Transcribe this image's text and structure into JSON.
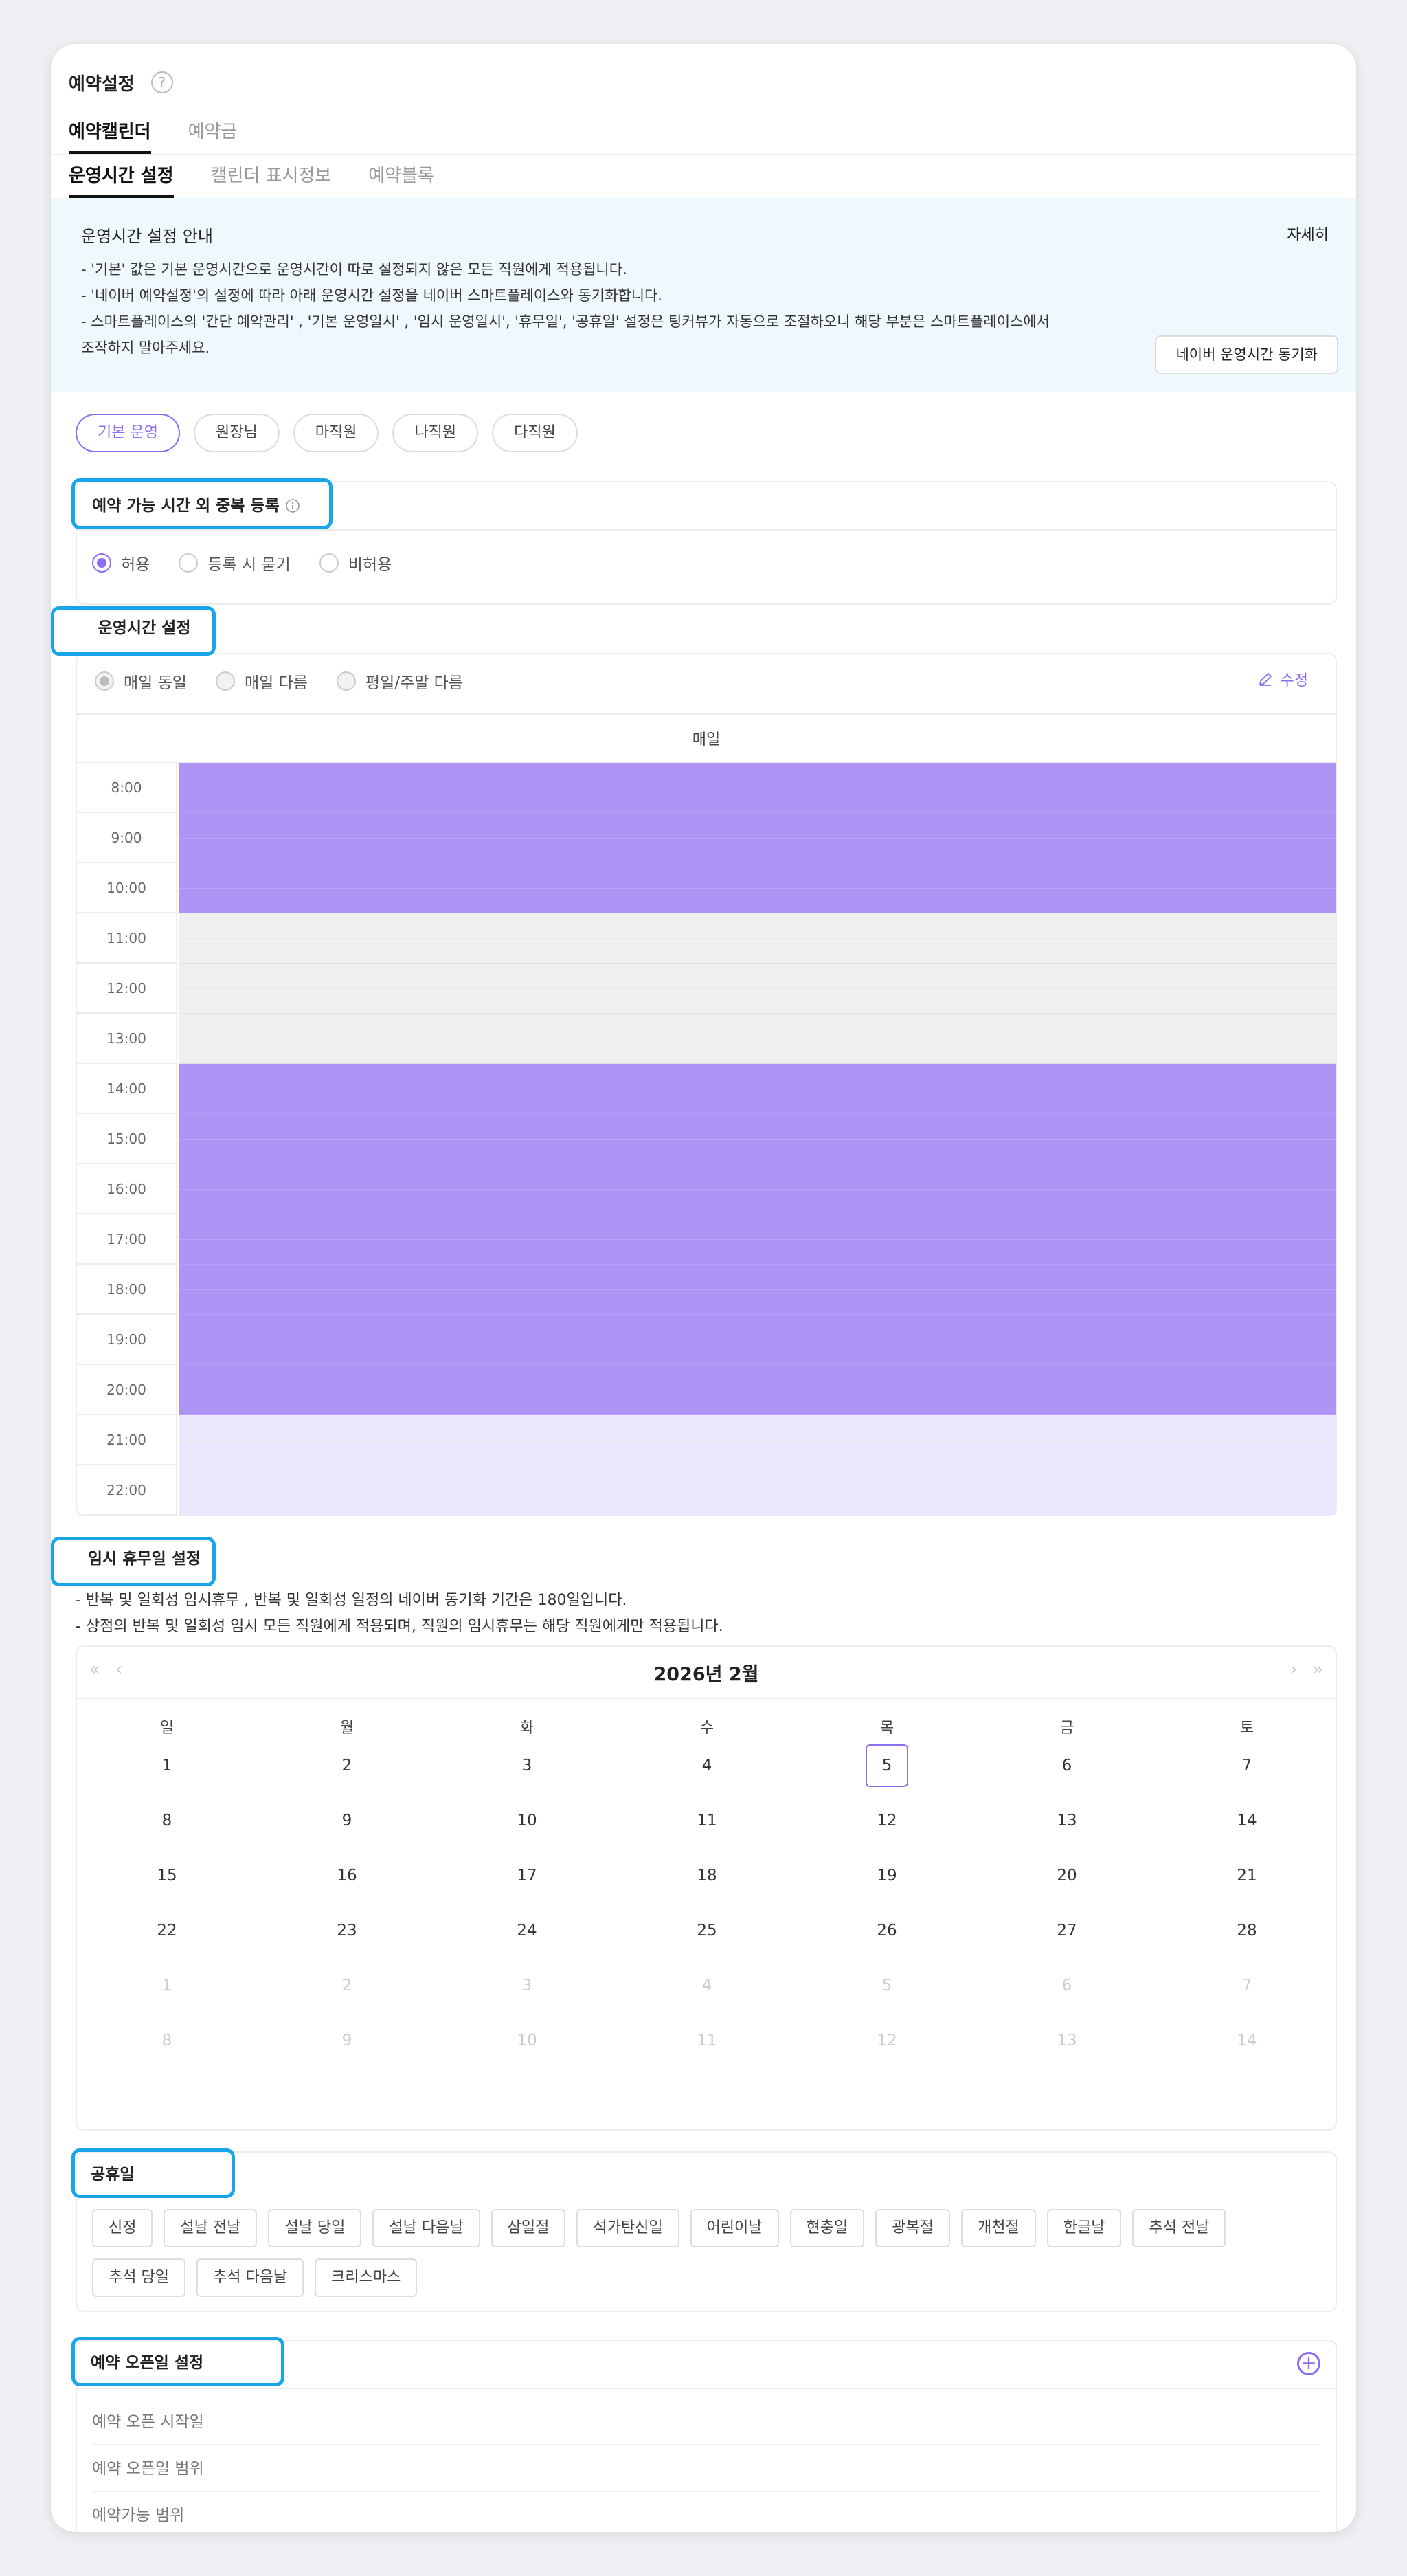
{
  "header": {
    "title": "예약설정",
    "help": "?"
  },
  "tabs": [
    "예약캘린더",
    "예약금"
  ],
  "subtabs": [
    "운영시간 설정",
    "캘린더 표시정보",
    "예약블록"
  ],
  "info": {
    "title": "운영시간 설정 안내",
    "more": "자세히",
    "lines": [
      "- '기본' 값은 기본 운영시간으로 운영시간이 따로 설정되지 않은 모든 직원에게 적용됩니다.",
      "- '네이버 예약설정'의 설정에 따라 아래 운영시간 설정을 네이버 스마트플레이스와 동기화합니다.",
      "- 스마트플레이스의 '간단 예약관리' , '기본 운영일시' , '임시 운영일시', '휴무일', '공휴일' 설정은 팅커뷰가 자동으로 조절하오니 해당 부분은 스마트플레이스에서",
      "조작하지 말아주세요."
    ],
    "sync_button": "네이버 운영시간 동기화"
  },
  "staff_chips": [
    "기본 운영",
    "원장님",
    "마직원",
    "나직원",
    "다직원"
  ],
  "overlap": {
    "title": "예약 가능 시간 외 중복 등록",
    "info_icon": "info-icon",
    "options": [
      "허용",
      "등록 시 묻기",
      "비허용"
    ],
    "selected": 0
  },
  "hours": {
    "title": "운영시간 설정",
    "options": [
      "매일 동일",
      "매일 다름",
      "평일/주말 다름"
    ],
    "selected": 0,
    "edit": "수정",
    "column": "매일",
    "slots": [
      {
        "time": "8:00",
        "state": "open"
      },
      {
        "time": "9:00",
        "state": "open"
      },
      {
        "time": "10:00",
        "state": "open"
      },
      {
        "time": "11:00",
        "state": "closed"
      },
      {
        "time": "12:00",
        "state": "closed"
      },
      {
        "time": "13:00",
        "state": "closed"
      },
      {
        "time": "14:00",
        "state": "open"
      },
      {
        "time": "15:00",
        "state": "open"
      },
      {
        "time": "16:00",
        "state": "open"
      },
      {
        "time": "17:00",
        "state": "open"
      },
      {
        "time": "18:00",
        "state": "open"
      },
      {
        "time": "19:00",
        "state": "open"
      },
      {
        "time": "20:00",
        "state": "open"
      },
      {
        "time": "21:00",
        "state": "after"
      },
      {
        "time": "22:00",
        "state": "after"
      }
    ],
    "colors": {
      "open": "#ae94f5",
      "closed": "#efefef",
      "after": "#ebe5fd"
    }
  },
  "temp_holiday": {
    "title": "임시 휴무일 설정",
    "notes": [
      "- 반복 및 일회성 임시휴무 , 반복 및 일회성 일정의 네이버 동기화 기간은 180일입니다.",
      "- 상점의 반복 및 일회성 임시 모든 직원에게 적용되며, 직원의 임시휴무는 해당 직원에게만 적용됩니다."
    ]
  },
  "calendar": {
    "month_label": "2026년 2월",
    "nav": {
      "prev_year": "«",
      "prev": "‹",
      "next": "›",
      "next_year": "»"
    },
    "weekdays": [
      "일",
      "월",
      "화",
      "수",
      "목",
      "금",
      "토"
    ],
    "weeks": [
      [
        "1",
        "2",
        "3",
        "4",
        "5",
        "6",
        "7"
      ],
      [
        "8",
        "9",
        "10",
        "11",
        "12",
        "13",
        "14"
      ],
      [
        "15",
        "16",
        "17",
        "18",
        "19",
        "20",
        "21"
      ],
      [
        "22",
        "23",
        "24",
        "25",
        "26",
        "27",
        "28"
      ],
      [
        "1",
        "2",
        "3",
        "4",
        "5",
        "6",
        "7"
      ],
      [
        "8",
        "9",
        "10",
        "11",
        "12",
        "13",
        "14"
      ]
    ],
    "today": "5"
  },
  "public_holidays": {
    "title": "공휴일",
    "items": [
      "신정",
      "설날 전날",
      "설날 당일",
      "설날 다음날",
      "삼일절",
      "석가탄신일",
      "어린이날",
      "현충일",
      "광복절",
      "개천절",
      "한글날",
      "추석 전날",
      "추석 당일",
      "추석 다음날",
      "크리스마스"
    ]
  },
  "open_date": {
    "title": "예약 오픈일 설정",
    "add_icon": "plus-circle-icon",
    "rows": [
      "예약 오픈 시작일",
      "예약 오픈일 범위",
      "예약가능 범위"
    ]
  }
}
